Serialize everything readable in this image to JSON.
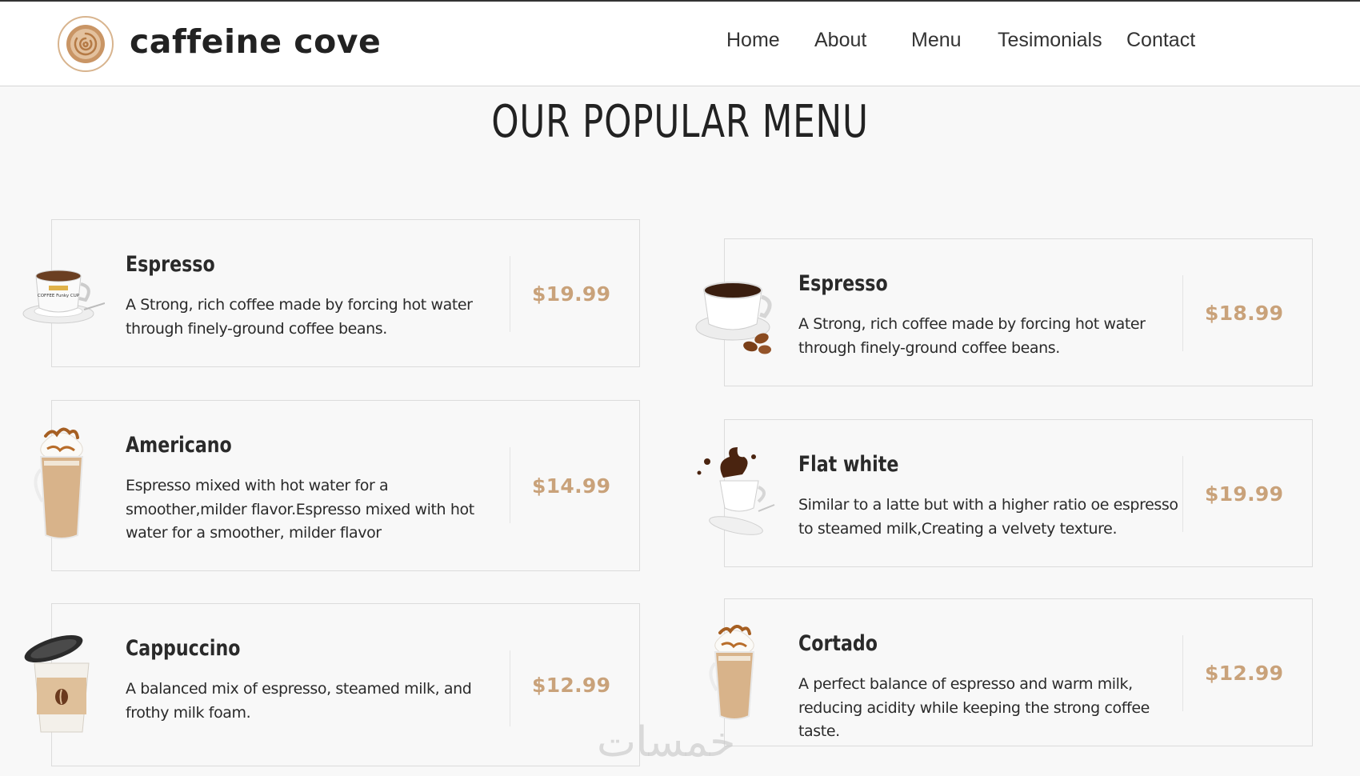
{
  "brand": {
    "name": "caffeine cove",
    "accent": "#c9a27a"
  },
  "nav": {
    "items": [
      {
        "label": "Home"
      },
      {
        "label": "About"
      },
      {
        "label": "Menu"
      },
      {
        "label": "Tesimonials"
      },
      {
        "label": "Contact"
      }
    ]
  },
  "section": {
    "title": "OUR POPULAR MENU"
  },
  "menu": {
    "left": [
      {
        "name": "Espresso",
        "description": "A Strong, rich coffee made by forcing hot water through finely-ground coffee beans.",
        "price": "$19.99",
        "image_icon": "coffee-cup-icon",
        "cup_text": "COFFEE Funky CUP"
      },
      {
        "name": "Americano",
        "description": "Espresso mixed with hot water for a smoother,milder flavor.Espresso mixed with hot water for a smoother, milder flavor",
        "price": "$14.99",
        "image_icon": "iced-latte-icon"
      },
      {
        "name": "Cappuccino",
        "description": "A balanced mix of espresso, steamed milk, and frothy milk foam.",
        "price": "$12.99",
        "image_icon": "takeaway-cup-icon"
      }
    ],
    "right": [
      {
        "name": "Espresso",
        "description": "A Strong, rich coffee made by forcing hot water through finely-ground coffee beans.",
        "price": "$18.99",
        "image_icon": "espresso-cup-icon"
      },
      {
        "name": "Flat white",
        "description": "Similar to a latte but with a higher ratio oe espresso to steamed milk,Creating a velvety texture.",
        "price": "$19.99",
        "image_icon": "splash-cup-icon"
      },
      {
        "name": "Cortado",
        "description": "A perfect balance of espresso and warm milk, reducing acidity while keeping the strong coffee taste.",
        "price": "$12.99",
        "image_icon": "iced-latte-icon"
      }
    ]
  },
  "watermark": {
    "text": "خمسات"
  }
}
